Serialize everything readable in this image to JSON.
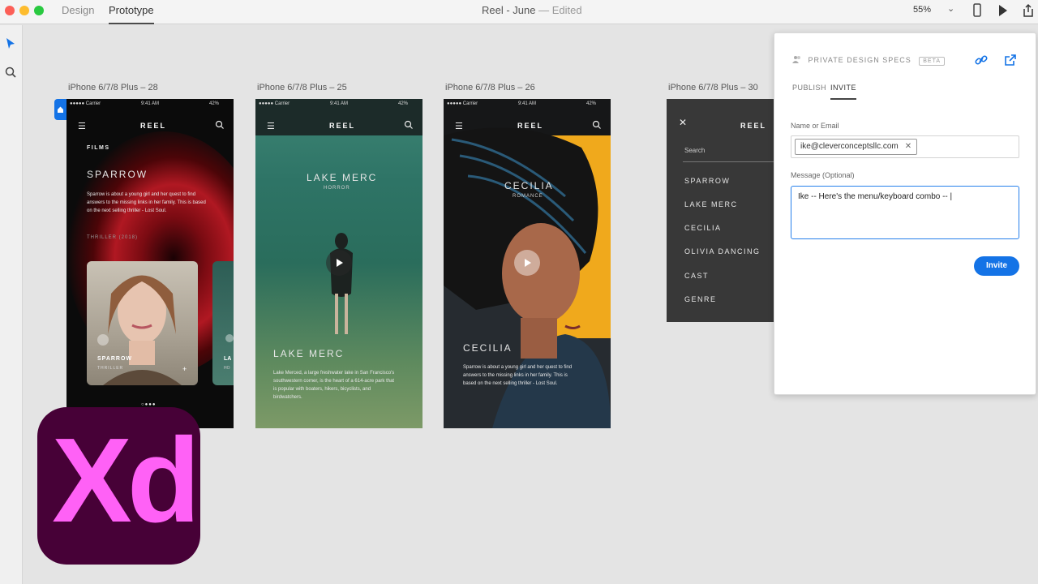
{
  "titlebar": {
    "tab_design": "Design",
    "tab_prototype": "Prototype",
    "doc_title": "Reel - June",
    "doc_dash": "—",
    "doc_status": "Edited",
    "zoom": "55%"
  },
  "artboards": [
    {
      "label": "iPhone 6/7/8 Plus – 28"
    },
    {
      "label": "iPhone 6/7/8 Plus – 25"
    },
    {
      "label": "iPhone 6/7/8 Plus – 26"
    },
    {
      "label": "iPhone 6/7/8 Plus – 30"
    }
  ],
  "phone": {
    "carrier": "●●●●● Carrier",
    "time": "9:41 AM",
    "battery": "42%",
    "app_title": "REEL"
  },
  "ab1": {
    "section": "FILMS",
    "title": "SPARROW",
    "description": "Sparrow is about a young girl and her quest to find answers to the missing links in her family. This is based on the next selling thriller - Lost Soul.",
    "meta": "THRILLER (2018)",
    "card_title": "SPARROW",
    "card_sub": "THRILLER",
    "card2_title": "LA",
    "card2_sub": "HO"
  },
  "ab2": {
    "title": "LAKE MERC",
    "genre": "HORROR",
    "bottom_title": "LAKE MERC",
    "description": "Lake Merced, a large freshwater lake in San Francisco's southwestern corner, is the heart of a 614-acre park that is popular with boaters, hikers, bicyclists, and birdwatchers."
  },
  "ab3": {
    "title": "CECILIA",
    "genre": "ROMANCE",
    "bottom_title": "CECILIA",
    "description": "Sparrow is about a young girl and her quest to find answers to the missing links in her family. This is based on the next selling thriller - Lost Soul."
  },
  "ab4": {
    "search": "Search",
    "menu": [
      "SPARROW",
      "LAKE MERC",
      "CECILIA",
      "OLIVIA DANCING",
      "CAST",
      "GENRE"
    ]
  },
  "share": {
    "heading": "PRIVATE DESIGN SPECS",
    "beta": "BETA",
    "tab_publish": "PUBLISH",
    "tab_invite": "INVITE",
    "name_label": "Name or Email",
    "email_chip": "ike@cleverconceptsllc.com",
    "message_label": "Message (Optional)",
    "message_value": "Ike -- Here's the menu/keyboard combo -- |",
    "invite_button": "Invite"
  },
  "logo": {
    "text": "Xd"
  },
  "colors": {
    "accent": "#1473e6",
    "xd_bg": "#470137",
    "xd_fg": "#ff61f6"
  }
}
